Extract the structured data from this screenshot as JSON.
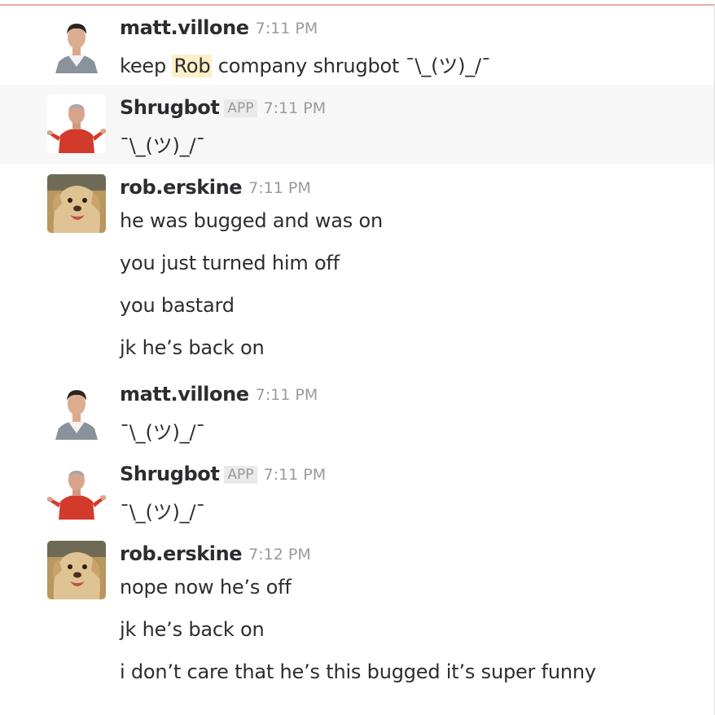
{
  "messages": [
    {
      "user": "matt.villone",
      "time": "7:11 PM",
      "avatar": "person-headshot-avatar",
      "text_parts": {
        "before": "keep ",
        "mention": "Rob",
        "after": " company shrugbot  ¯\\_(ツ)_/¯"
      }
    },
    {
      "user": "Shrugbot",
      "badge": "APP",
      "time": "7:11 PM",
      "avatar": "shrugging-man-avatar",
      "lines": [
        "¯\\_(ツ)_/¯"
      ]
    },
    {
      "user": "rob.erskine",
      "time": "7:11 PM",
      "avatar": "dog-avatar",
      "lines": [
        "he was bugged and was on",
        "you just turned him off",
        "you bastard",
        "jk he’s back on"
      ]
    },
    {
      "user": "matt.villone",
      "time": "7:11 PM",
      "avatar": "person-headshot-avatar",
      "lines": [
        "¯\\_(ツ)_/¯"
      ]
    },
    {
      "user": "Shrugbot",
      "badge": "APP",
      "time": "7:11 PM",
      "avatar": "shrugging-man-avatar",
      "lines": [
        "¯\\_(ツ)_/¯"
      ]
    },
    {
      "user": "rob.erskine",
      "time": "7:12 PM",
      "avatar": "dog-avatar",
      "lines": [
        "nope now he’s off",
        "jk he’s back on",
        "i don’t care that he’s this bugged it’s super funny"
      ]
    }
  ],
  "colors": {
    "mention_highlight": "#fdf0c7",
    "hover_row": "#f7f7f7",
    "unread_divider": "#e9a9a9",
    "timestamp": "#9a9a9a"
  }
}
